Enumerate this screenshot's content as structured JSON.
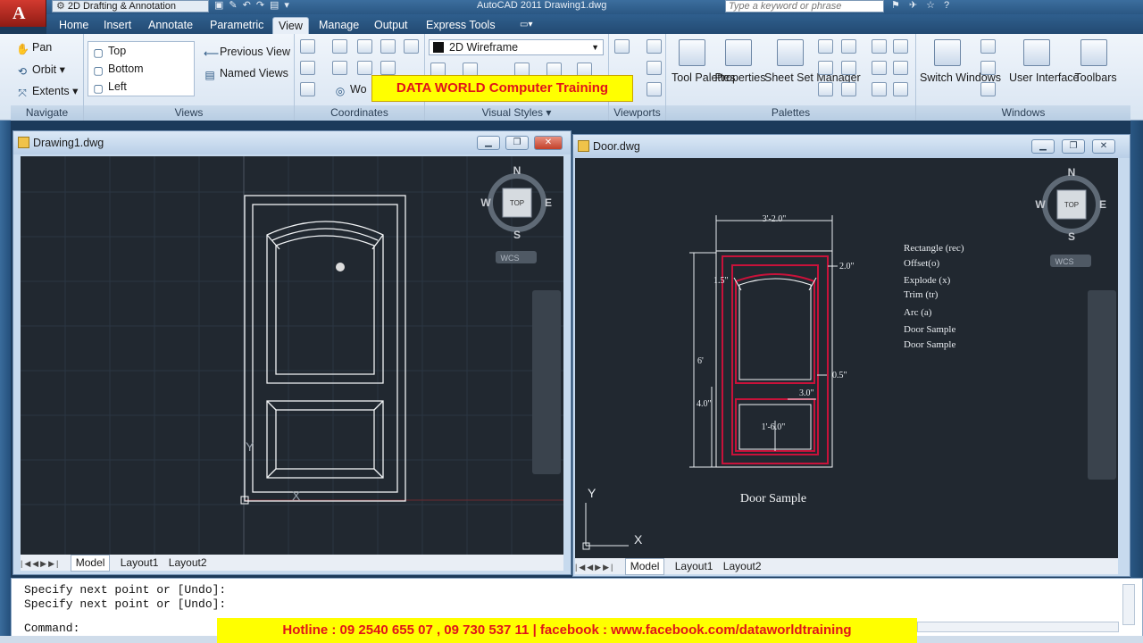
{
  "app": {
    "title": "AutoCAD 2011    Drawing1.dwg",
    "logo_letter": "A",
    "workspace": "2D Drafting & Annotation",
    "search_placeholder": "Type a keyword or phrase"
  },
  "ribbon_tabs": [
    "Home",
    "Insert",
    "Annotate",
    "Parametric",
    "View",
    "Manage",
    "Output",
    "Express Tools"
  ],
  "active_tab": "View",
  "navigate": {
    "pan": "Pan",
    "orbit": "Orbit",
    "extents": "Extents",
    "title": "Navigate"
  },
  "views": {
    "items": [
      "Top",
      "Bottom",
      "Left"
    ],
    "previous": "Previous View",
    "named": "Named Views",
    "title": "Views"
  },
  "coordinates": {
    "title": "Coordinates",
    "world_label": "Wo"
  },
  "visual_styles": {
    "current": "2D Wireframe",
    "title": "Visual Styles"
  },
  "viewports": {
    "title": "Viewports"
  },
  "palettes": {
    "tool_palettes": "Tool Palettes",
    "properties": "Properties",
    "sheet_set": "Sheet Set Manager",
    "title": "Palettes"
  },
  "windows": {
    "switch": "Switch Windows",
    "user_interface": "User Interface",
    "toolbars": "Toolbars",
    "title": "Windows"
  },
  "banner_top": "DATA WORLD Computer Training",
  "drawing1": {
    "title": "Drawing1.dwg",
    "layout_tabs": [
      "Model",
      "Layout1",
      "Layout2"
    ],
    "viewcube": {
      "n": "N",
      "s": "S",
      "e": "E",
      "w": "W",
      "face": "TOP",
      "wcs": "WCS"
    }
  },
  "door": {
    "title": "Door.dwg",
    "layout_tabs": [
      "Model",
      "Layout1",
      "Layout2"
    ],
    "viewcube": {
      "n": "N",
      "s": "S",
      "e": "E",
      "w": "W",
      "face": "TOP",
      "wcs": "WCS"
    },
    "dimensions": {
      "width": "3'-2.0\"",
      "top_right": "2.0\"",
      "left_small": "1.5\"",
      "height": "6'",
      "mid_right": "0.5\"",
      "rail": "3.0\"",
      "left_lower": "4.0\"",
      "panel": "1'-6.0\""
    },
    "notes": [
      "Rectangle (rec)",
      "Offset(o)",
      "Explode (x)",
      "Trim (tr)",
      "Arc (a)",
      "Door Sample",
      "Door Sample"
    ],
    "caption": "Door Sample",
    "ucs": {
      "x": "X",
      "y": "Y"
    }
  },
  "command": {
    "lines": [
      "Specify next point or [Undo]:",
      "Specify next point or [Undo]:"
    ],
    "prompt": "Command:"
  },
  "banner_bottom": "Hotline : 09 2540 655 07 , 09 730 537 11 | facebook : www.facebook.com/dataworldtraining",
  "colors": {
    "canvas": "#212830",
    "door_red": "#c8123a",
    "banner": "#ffff00",
    "banner_text": "#e0141a"
  }
}
